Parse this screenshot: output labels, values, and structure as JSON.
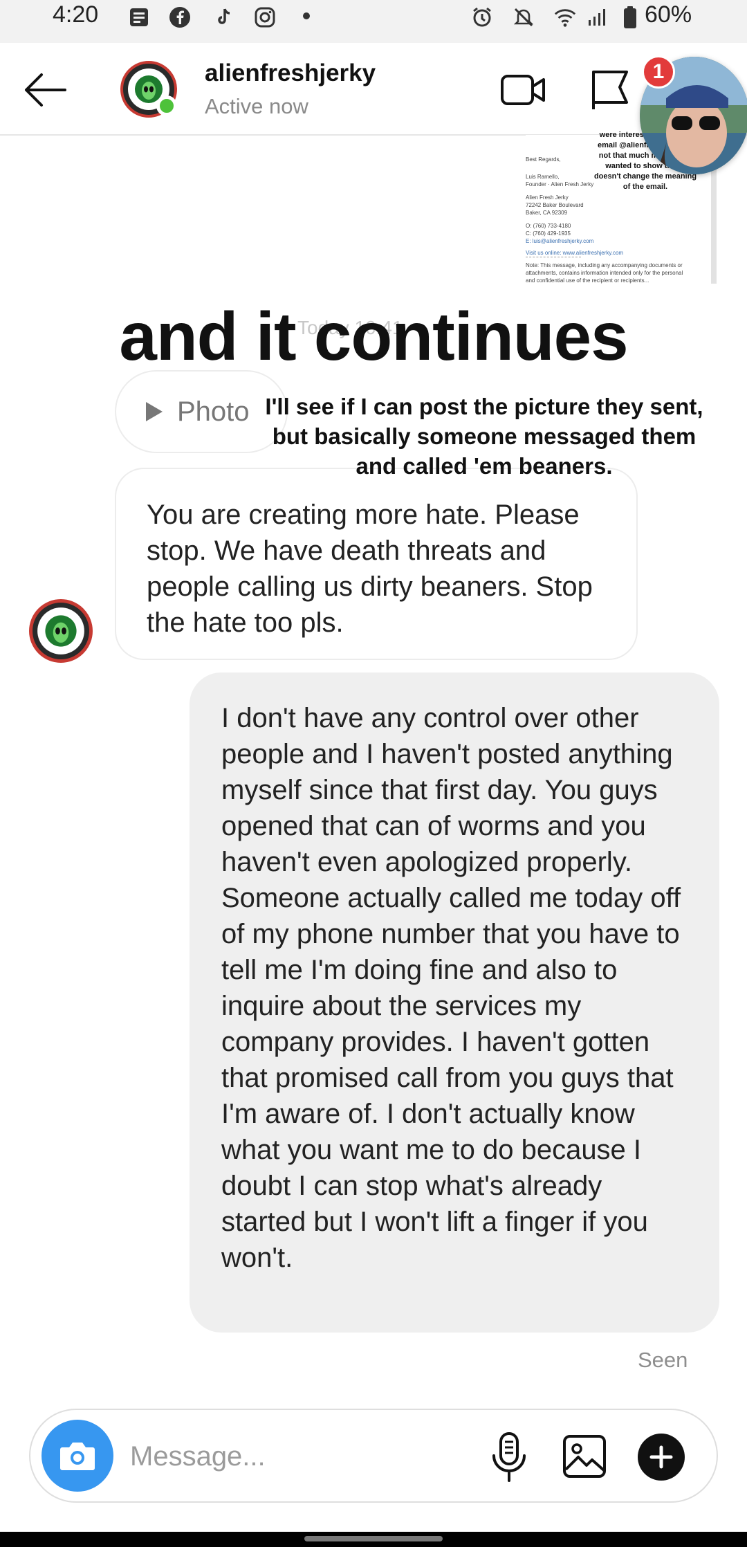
{
  "status_bar": {
    "time": "4:20",
    "battery": "60%",
    "icons": [
      "notes-icon",
      "facebook-icon",
      "tiktok-icon",
      "instagram-icon",
      "alarm-icon",
      "mute-icon",
      "wifi-icon",
      "signal-icon",
      "battery-icon"
    ]
  },
  "header": {
    "username": "alienfreshjerky",
    "status": "Active now",
    "notification_count": "1"
  },
  "embedded_email": {
    "lines": [
      "Best Regards,",
      "Luis Ramello,",
      "Founder · Alien Fresh Jerky",
      "Alien Fresh Jerky",
      "72242 Baker Boulevard",
      "Baker, CA 92309",
      "O: (760) 733-4180",
      "C: (760) 429-1935",
      "E: luis@alienfreshjerky.com",
      "Visit us online: www.alienfreshjerky.com",
      "Note: This message, including any accompanying documents or attachments, contains information intended only for the personal and confidential use of the recipient or recipients..."
    ],
    "overlay_note": "were interested in the full email @alienfreshjerky it's not that much more. I just wanted to show that it doesn't change the meaning of the email."
  },
  "captions": {
    "big": "and it continues",
    "small": "I'll see if I can post the picture they sent, but basically someone messaged them and called 'em beaners."
  },
  "timestamp": "Today 10:41",
  "messages": {
    "photo_label": "Photo",
    "incoming": "You are creating more hate. Please stop. We have death threats and people calling us dirty beaners. Stop the hate too pls.",
    "outgoing": "I don't have any control over other people and I haven't posted anything myself since that first day. You guys opened that can of worms and you haven't even apologized properly. Someone actually called me today off of my phone number that you have to tell me I'm doing fine and also to inquire about the services my company provides. I haven't gotten that promised call from you guys that I'm aware of. I don't actually know what you want me to do because I doubt I can stop what's already started but I won't lift a finger if you won't.",
    "seen": "Seen"
  },
  "composer": {
    "placeholder": "Message..."
  },
  "colors": {
    "accent_blue": "#3797f0",
    "online_green": "#4ec23a",
    "notification_red": "#e23b3b",
    "brand_red": "#c73a32"
  }
}
